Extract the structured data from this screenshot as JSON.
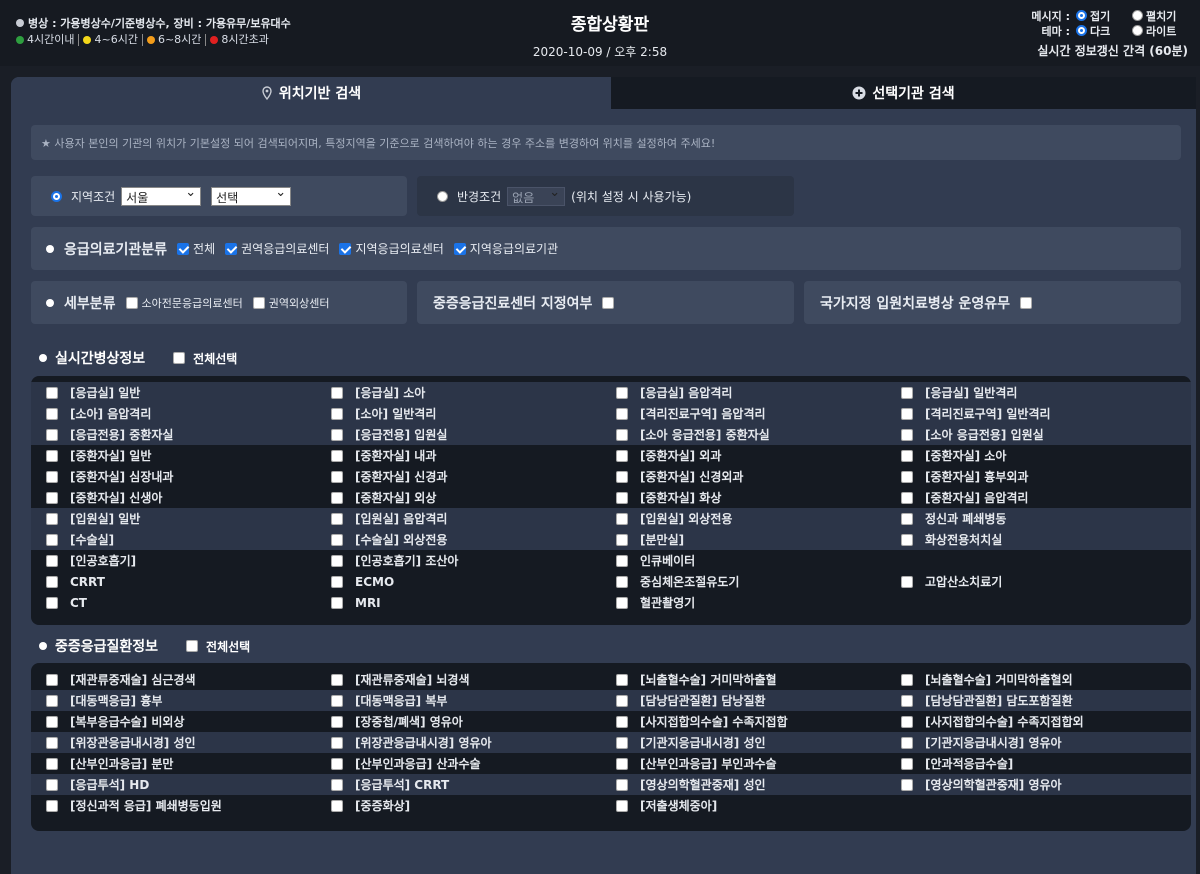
{
  "header": {
    "title": "종합상황판",
    "datetime": "2020-10-09 / 오후 2:58",
    "legend_text": "병상 : 가용병상수/기준병상수, 장비 : 가용유무/보유대수",
    "status_legend": [
      {
        "label": "4시간이내",
        "color": "#2e9e3f"
      },
      {
        "label": "4~6시간",
        "color": "#f3d71a"
      },
      {
        "label": "6~8시간",
        "color": "#f39c1a"
      },
      {
        "label": "8시간초과",
        "color": "#e02020"
      }
    ],
    "message_label": "메시지 :",
    "message_options": [
      "접기",
      "펼치기"
    ],
    "theme_label": "테마 :",
    "theme_options": [
      "다크",
      "라이트"
    ],
    "refresh_text": "실시간 정보갱신 간격 (60분)"
  },
  "tabs": [
    {
      "label": "위치기반 검색",
      "icon": "map-pin-icon"
    },
    {
      "label": "선택기관 검색",
      "icon": "plus-circle-icon"
    }
  ],
  "notice": "★ 사용자 본인의 기관의 위치가 기본설정 되어 검색되어지며, 특정지역을 기준으로 검색하여야 하는 경우 주소를 변경하여 위치를 설정하여 주세요!",
  "region": {
    "label": "지역조건",
    "city": "서울",
    "district": "선택"
  },
  "radius": {
    "label": "반경조건",
    "value": "없음",
    "note": "(위치 설정 시 사용가능)"
  },
  "classification": {
    "label": "응급의료기관분류",
    "options": [
      "전체",
      "권역응급의료센터",
      "지역응급의료센터",
      "지역응급의료기관"
    ]
  },
  "detail": {
    "label": "세부분류",
    "options": [
      "소아전문응급의료센터",
      "권역외상센터"
    ]
  },
  "severe_center_label": "중증응급진료센터 지정여부",
  "national_ward_label": "국가지정 입원치료병상 운영유무",
  "realtime": {
    "title": "실시간병상정보",
    "select_all": "전체선택",
    "rows": [
      [
        "[응급실] 일반",
        "[응급실] 소아",
        "[응급실] 음압격리",
        "[응급실] 일반격리"
      ],
      [
        "[소아] 음압격리",
        "[소아] 일반격리",
        "[격리진료구역] 음압격리",
        "[격리진료구역] 일반격리"
      ],
      [
        "[응급전용] 중환자실",
        "[응급전용] 입원실",
        "[소아 응급전용] 중환자실",
        "[소아 응급전용] 입원실"
      ],
      [
        "[중환자실] 일반",
        "[중환자실] 내과",
        "[중환자실] 외과",
        "[중환자실] 소아"
      ],
      [
        "[중환자실] 심장내과",
        "[중환자실] 신경과",
        "[중환자실] 신경외과",
        "[중환자실] 흉부외과"
      ],
      [
        "[중환자실] 신생아",
        "[중환자실] 외상",
        "[중환자실] 화상",
        "[중환자실] 음압격리"
      ],
      [
        "[입원실] 일반",
        "[입원실] 음압격리",
        "[입원실] 외상전용",
        "정신과 폐쇄병동"
      ],
      [
        "[수술실]",
        "[수술실] 외상전용",
        "[분만실]",
        "화상전용처치실"
      ],
      [
        "[인공호흡기]",
        "[인공호흡기] 조산아",
        "인큐베이터",
        ""
      ],
      [
        "CRRT",
        "ECMO",
        "중심체온조절유도기",
        "고압산소치료기"
      ],
      [
        "CT",
        "MRI",
        "혈관촬영기",
        ""
      ]
    ]
  },
  "severe": {
    "title": "중증응급질환정보",
    "select_all": "전체선택",
    "rows": [
      [
        "[재관류중재술] 심근경색",
        "[재관류중재술] 뇌경색",
        "[뇌출혈수술] 거미막하출혈",
        "[뇌출혈수술] 거미막하출혈외"
      ],
      [
        "[대동맥응급] 흉부",
        "[대동맥응급] 복부",
        "[담낭담관질환] 담낭질환",
        "[담낭담관질환] 담도포함질환"
      ],
      [
        "[복부응급수술] 비외상",
        "[장중첩/폐색] 영유아",
        "[사지접합의수술] 수족지접합",
        "[사지접합의수술] 수족지접합외"
      ],
      [
        "[위장관응급내시경] 성인",
        "[위장관응급내시경] 영유아",
        "[기관지응급내시경] 성인",
        "[기관지응급내시경] 영유아"
      ],
      [
        "[산부인과응급] 분만",
        "[산부인과응급] 산과수술",
        "[산부인과응급] 부인과수술",
        "[안과적응급수술]"
      ],
      [
        "[응급투석] HD",
        "[응급투석] CRRT",
        "[영상의학혈관중재] 성인",
        "[영상의학혈관중재] 영유아"
      ],
      [
        "[정신과적 응급] 폐쇄병동입원",
        "[중증화상]",
        "[저출생체중아]",
        ""
      ]
    ]
  }
}
